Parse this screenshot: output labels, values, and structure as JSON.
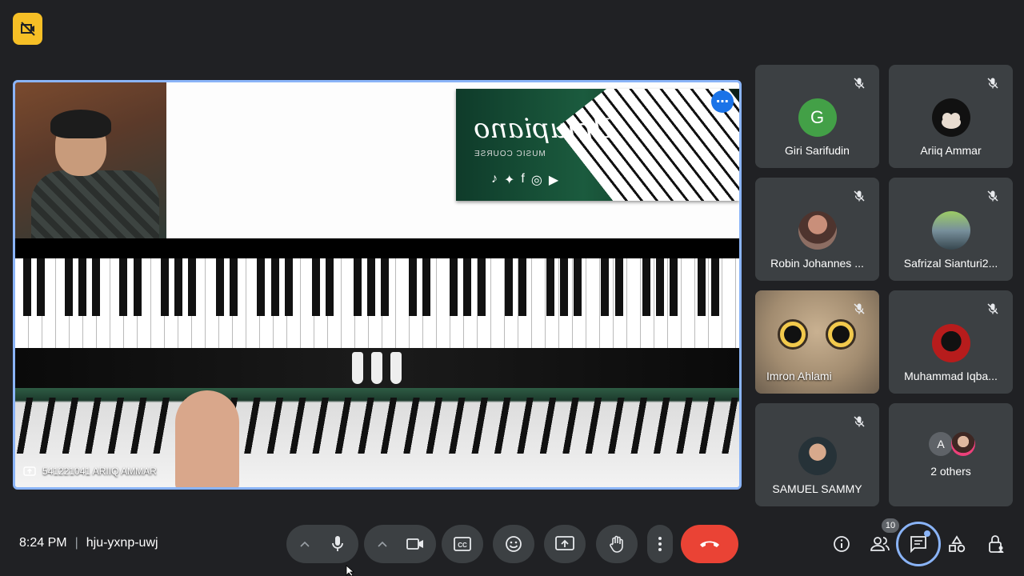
{
  "meeting": {
    "time": "8:24 PM",
    "separator": "|",
    "code": "hju-yxnp-uwj"
  },
  "presentation": {
    "presenter_label": "541221041 ARIIQ AMMAR",
    "banner": {
      "brand": "Ilmupiano",
      "subtitle": "MUSIC COURSE"
    }
  },
  "participants": [
    {
      "name": "Giri Sarifudin",
      "initial": "G",
      "avatar_color": "#43a047",
      "muted": true
    },
    {
      "name": "Ariiq Ammar",
      "initial": "",
      "avatar_color": "#111111",
      "muted": true
    },
    {
      "name": "Robin Johannes ...",
      "initial": "",
      "avatar_color": "#6d4c41",
      "muted": true
    },
    {
      "name": "Safrizal Sianturi2...",
      "initial": "",
      "avatar_color": "#607d8b",
      "muted": true
    },
    {
      "name": "Imron Ahlami",
      "initial": "",
      "avatar_color": "#a28c70",
      "muted": true
    },
    {
      "name": "Muhammad Iqba...",
      "initial": "",
      "avatar_color": "#b71c1c",
      "muted": true
    },
    {
      "name": "SAMUEL SAMMY",
      "initial": "",
      "avatar_color": "#37474f",
      "muted": true
    },
    {
      "name": "2 others",
      "initial": "A",
      "avatar_color": "#5f6368",
      "muted": false
    }
  ],
  "controls": {
    "people_count": "10"
  },
  "colors": {
    "background": "#202124",
    "tile": "#3c4043",
    "accent": "#8ab4f8",
    "end_call": "#ea4335",
    "record": "#f6bf26"
  }
}
